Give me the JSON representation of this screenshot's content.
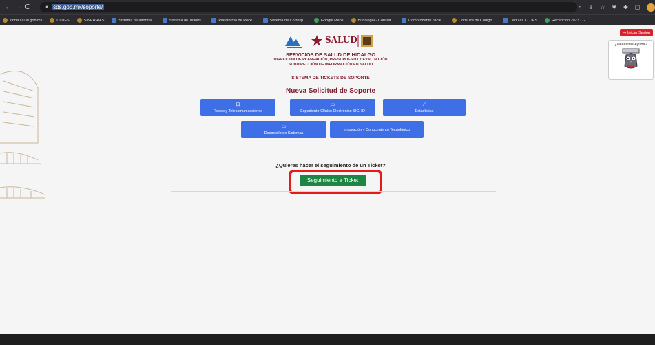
{
  "browser": {
    "url": "sds.gob.mx/soporte/",
    "bookmarks": [
      {
        "label": "sinba.salud.gob.mx",
        "icon": "globe-icon"
      },
      {
        "label": "CLUES",
        "icon": "globe-icon"
      },
      {
        "label": "SINERHIAS",
        "icon": "globe-icon"
      },
      {
        "label": "Sistema de Informa...",
        "icon": "doc-icon"
      },
      {
        "label": "Sistema de Tickets...",
        "icon": "doc-icon"
      },
      {
        "label": "Plataforma de Rece...",
        "icon": "doc-icon"
      },
      {
        "label": "Sistema de Corresp...",
        "icon": "doc-icon"
      },
      {
        "label": "Google Maps",
        "icon": "map-pin-icon"
      },
      {
        "label": "Buholegal - Consult...",
        "icon": "globe-icon"
      },
      {
        "label": "Comprobante fiscal...",
        "icon": "doc-icon"
      },
      {
        "label": "Consulta de Código...",
        "icon": "globe-icon"
      },
      {
        "label": "Cedulas CLUES",
        "icon": "doc-icon"
      },
      {
        "label": "Recepción 2023 - G...",
        "icon": "drive-icon"
      }
    ]
  },
  "header": {
    "salud_text": "SALUD",
    "org": "SERVICIOS DE SALUD DE HIDALGO",
    "dept": "DIRECCIÓN DE PLANEACIÓN, PRESUPUESTO Y EVALUACIÓN",
    "subdept": "SUBDIRECCIÓN DE INFORMACIÓN EN SALUD",
    "system": "SISTEMA DE TICKETS DE SOPORTE",
    "title": "Nueva Solicitud de Soporte"
  },
  "login_label": "Iniciar Sesión",
  "help_label": "¿Necesitas Ayuda?",
  "categories": [
    {
      "label": "Redes y Telecomunicaciones",
      "icon": "network-icon"
    },
    {
      "label": "Expediente Clínico Electrónico SIGHO",
      "icon": "monitor-icon"
    },
    {
      "label": "Estadística",
      "icon": "chart-icon"
    },
    {
      "label": "Desarrollo de Sistemas",
      "icon": "monitor-icon"
    },
    {
      "label": "Innovación y Conocimiento Tecnológico",
      "icon": ""
    }
  ],
  "tracking": {
    "question": "¿Quieres hacer el seguimiento de un Ticket?",
    "button": "Seguimiento a Ticket"
  },
  "colors": {
    "brand": "#7a1e2e",
    "primary": "#3f6fe6",
    "success": "#1c8744",
    "highlight": "#e31b1b"
  }
}
